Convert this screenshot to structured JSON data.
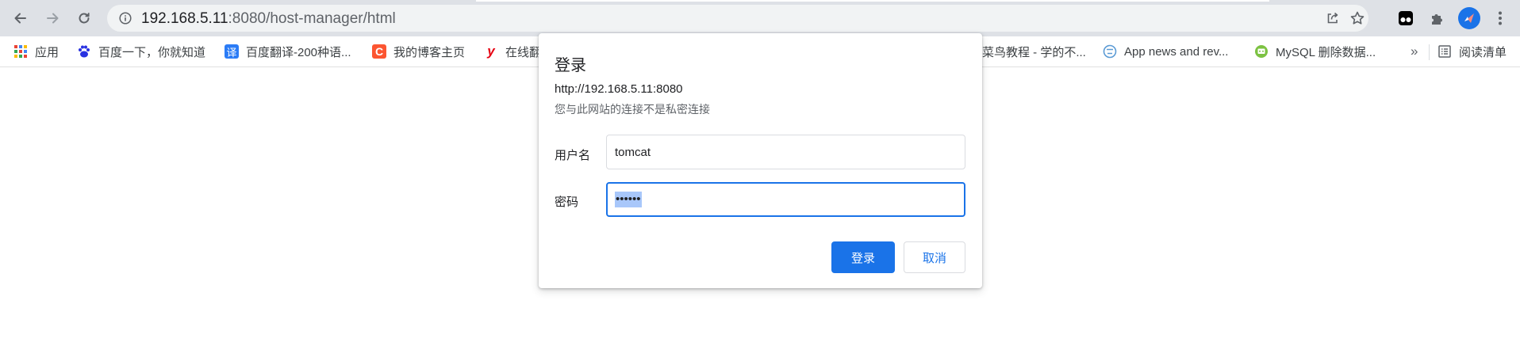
{
  "browser": {
    "url_host": "192.168.5.11",
    "url_path": ":8080/host-manager/html",
    "icons": {
      "back": "arrow-left-icon",
      "forward": "arrow-right-icon",
      "reload": "reload-icon",
      "site_info": "info-icon",
      "share": "share-icon",
      "bookmark_star": "star-icon",
      "extension": "puzzle-icon",
      "menu": "kebab-menu-icon"
    }
  },
  "bookmarks": [
    {
      "label": "应用",
      "icon": "apps-grid-icon"
    },
    {
      "label": "百度一下，你就知道",
      "icon": "baidu-paw-icon"
    },
    {
      "label": "百度翻译-200种语...",
      "icon": "translate-icon"
    },
    {
      "label": "我的博客主页",
      "icon": "csdn-c-icon"
    },
    {
      "label": "在线翻",
      "icon": "youdao-y-icon"
    },
    {
      "label": "菜鸟教程 - 学的不...",
      "icon": ""
    },
    {
      "label": "App news and rev...",
      "icon": "app-news-icon"
    },
    {
      "label": "MySQL 删除数据...",
      "icon": "mysql-site-icon"
    }
  ],
  "bookmarks_overflow": "»",
  "reading_list": {
    "label": "阅读清单",
    "icon": "reading-list-icon"
  },
  "dialog": {
    "title": "登录",
    "origin": "http://192.168.5.11:8080",
    "warning": "您与此网站的连接不是私密连接",
    "username_label": "用户名",
    "username_value": "tomcat",
    "password_label": "密码",
    "password_mask": "••••••",
    "sign_in_label": "登录",
    "cancel_label": "取消"
  },
  "colors": {
    "accent": "#1a73e8",
    "toolbar": "#dee1e6",
    "omnibox": "#f1f3f4",
    "selection": "#a8c7fa"
  }
}
